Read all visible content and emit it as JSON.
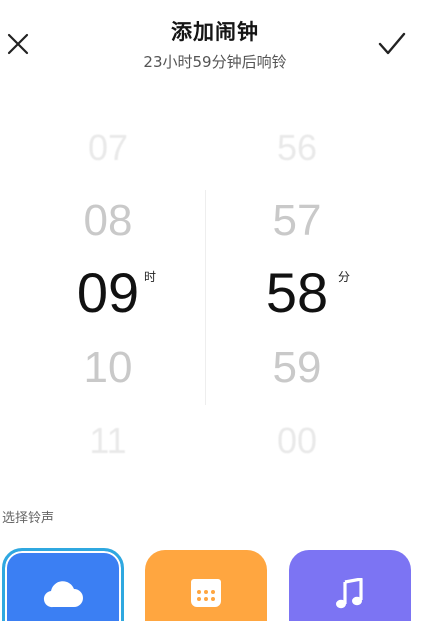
{
  "header": {
    "title": "添加闹钟",
    "subtitle": "23小时59分钟后响铃",
    "close_icon": "close-icon",
    "confirm_icon": "check-icon"
  },
  "picker": {
    "hours": {
      "far_above": "07",
      "above": "08",
      "selected": "09",
      "below": "10",
      "far_below": "11",
      "unit": "时"
    },
    "minutes": {
      "far_above": "56",
      "above": "57",
      "selected": "58",
      "below": "59",
      "far_below": "00",
      "unit": "分"
    }
  },
  "ringtone": {
    "label": "选择铃声",
    "options": [
      {
        "icon": "cloud-icon",
        "color": "#3b7ff3",
        "selected": true
      },
      {
        "icon": "calendar-icon",
        "color": "#ffa640",
        "selected": false
      },
      {
        "icon": "music-note-icon",
        "color": "#7c74f3",
        "selected": false
      }
    ]
  },
  "colors": {
    "selected_border": "#2fa8e0"
  }
}
